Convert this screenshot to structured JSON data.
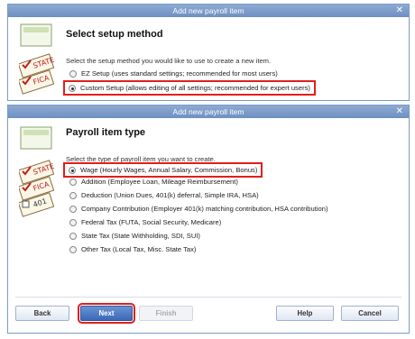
{
  "back_dialog": {
    "title": "Add new payroll item",
    "heading": "Select setup method",
    "instruction": "Select the setup method you would like to use to create a new item.",
    "options": [
      {
        "label": "EZ Setup (uses standard settings; recommended for most users)",
        "selected": false
      },
      {
        "label": "Custom Setup (allows editing of all settings; recommended for expert users)",
        "selected": true
      }
    ]
  },
  "front_dialog": {
    "title": "Add new payroll item",
    "heading": "Payroll item type",
    "instruction": "Select the type of payroll item you want to create.",
    "options": [
      {
        "label": "Wage (Hourly Wages, Annual Salary, Commission, Bonus)",
        "selected": true
      },
      {
        "label": "Addition (Employee Loan, Mileage Reimbursement)",
        "selected": false
      },
      {
        "label": "Deduction (Union Dues, 401(k) deferral, Simple IRA, HSA)",
        "selected": false
      },
      {
        "label": "Company Contribution (Employer 401(k) matching contribution, HSA contribution)",
        "selected": false
      },
      {
        "label": "Federal Tax (FUTA, Social Security, Medicare)",
        "selected": false
      },
      {
        "label": "State Tax (State Withholding, SDI, SUI)",
        "selected": false
      },
      {
        "label": "Other Tax (Local Tax, Misc. State Tax)",
        "selected": false
      }
    ],
    "buttons": {
      "back": "Back",
      "next": "Next",
      "finish": "Finish",
      "help": "Help",
      "cancel": "Cancel"
    }
  },
  "graphic_labels": {
    "state": "STATE",
    "fica": "FICA",
    "k401": "401"
  },
  "colors": {
    "titlebar": "#7a9cc6",
    "highlight": "#e0201c",
    "primary_button": "#3a69b8"
  }
}
